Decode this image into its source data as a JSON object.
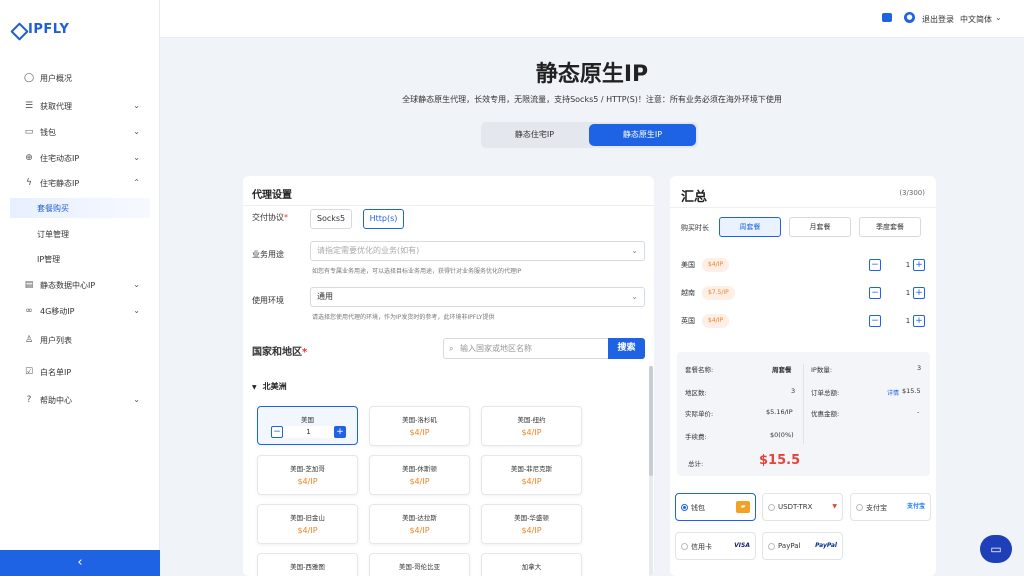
{
  "brand": {
    "name": "IPFLY",
    "color": "#1f5fd6"
  },
  "sidebar": {
    "items": [
      {
        "label": "用户概况",
        "icon": "user-icon"
      },
      {
        "label": "获取代理",
        "icon": "database-icon"
      },
      {
        "label": "钱包",
        "icon": "wallet-icon"
      },
      {
        "label": "住宅动态IP",
        "icon": "globe-icon"
      },
      {
        "label": "住宅静态IP",
        "icon": "bolt-icon"
      },
      {
        "label": "套餐购买"
      },
      {
        "label": "订单管理"
      },
      {
        "label": "IP管理"
      },
      {
        "label": "静态数据中心IP",
        "icon": "server-icon"
      },
      {
        "label": "4G移动IP",
        "icon": "link-icon"
      },
      {
        "label": "用户列表",
        "icon": "users-icon"
      },
      {
        "label": "白名单IP",
        "icon": "list-check-icon"
      },
      {
        "label": "帮助中心",
        "icon": "help-icon"
      }
    ],
    "collapse": "‹"
  },
  "topbar": {
    "logout": "退出登录",
    "language": "中文简体"
  },
  "page": {
    "title": "静态原生IP",
    "subtitle": "全球静态原生代理，长效专用，无限流量，支持Socks5 / HTTP(S)！注意：所有业务必须在海外环境下使用",
    "tabs": [
      "静态住宅IP",
      "静态原生IP"
    ]
  },
  "proxy": {
    "title": "代理设置",
    "protocol_label": "交付协议",
    "protocols": [
      "Socks5",
      "Http(s)"
    ],
    "purpose_label": "业务用途",
    "purpose_placeholder": "请指定需要优化的业务(如有)",
    "purpose_hint": "如您有专属业务用途，可以选择目标业务用途，获得针对业务服务优化的代理IP",
    "env_label": "使用环境",
    "env_value": "通用",
    "env_hint": "请选择您使用代理的环境，作为IP发货时的参考，此环境非IPFLY提供",
    "country_title": "国家和地区",
    "search_placeholder": "输入国家或地区名称",
    "search_button": "搜索",
    "region": "北美洲",
    "countries": [
      {
        "name": "美国",
        "price": "$4/IP",
        "qty": "1"
      },
      {
        "name": "美国-洛杉矶",
        "price": "$4/IP"
      },
      {
        "name": "美国-纽约",
        "price": "$4/IP"
      },
      {
        "name": "美国-芝加哥",
        "price": "$4/IP"
      },
      {
        "name": "美国-休斯顿",
        "price": "$4/IP"
      },
      {
        "name": "美国-菲尼克斯",
        "price": "$4/IP"
      },
      {
        "name": "美国-旧金山",
        "price": "$4/IP"
      },
      {
        "name": "美国-达拉斯",
        "price": "$4/IP"
      },
      {
        "name": "美国-华盛顿",
        "price": "$4/IP"
      },
      {
        "name": "美国-西雅图",
        "price": ""
      },
      {
        "name": "美国-哥伦比亚",
        "price": ""
      },
      {
        "name": "加拿大",
        "price": ""
      }
    ]
  },
  "summary": {
    "title": "汇总",
    "count": "(3/300)",
    "period_label": "购买时长",
    "periods": [
      "周套餐",
      "月套餐",
      "季度套餐"
    ],
    "items": [
      {
        "name": "美国",
        "price": "$4/IP",
        "qty": "1"
      },
      {
        "name": "越南",
        "price": "$7.5/IP",
        "qty": "1"
      },
      {
        "name": "英国",
        "price": "$4/IP",
        "qty": "1"
      }
    ],
    "details": {
      "plan_label": "套餐名称:",
      "plan_value": "周套餐",
      "ip_label": "IP数量:",
      "ip_value": "3",
      "region_label": "地区数:",
      "region_value": "3",
      "order_label": "订单总额:",
      "order_link": "详情",
      "order_value": "$15.5",
      "unit_label": "实际单价:",
      "unit_value": "$5.16/IP",
      "discount_label": "优惠金额:",
      "discount_value": "-",
      "fee_label": "手续费:",
      "fee_value": "$0(0%)",
      "total_label": "总计:",
      "total_value": "$15.5"
    },
    "payments": [
      {
        "label": "钱包",
        "icon_text": "▰"
      },
      {
        "label": "USDT-TRX",
        "icon_text": "▼"
      },
      {
        "label": "支付宝",
        "icon_text": "支付宝"
      },
      {
        "label": "信用卡",
        "icon_text": "VISA"
      },
      {
        "label": "PayPal",
        "icon_text": "PayPal"
      }
    ]
  },
  "colors": {
    "accent": "#1f63e5",
    "price": "#f58220",
    "total": "#e5443a"
  }
}
